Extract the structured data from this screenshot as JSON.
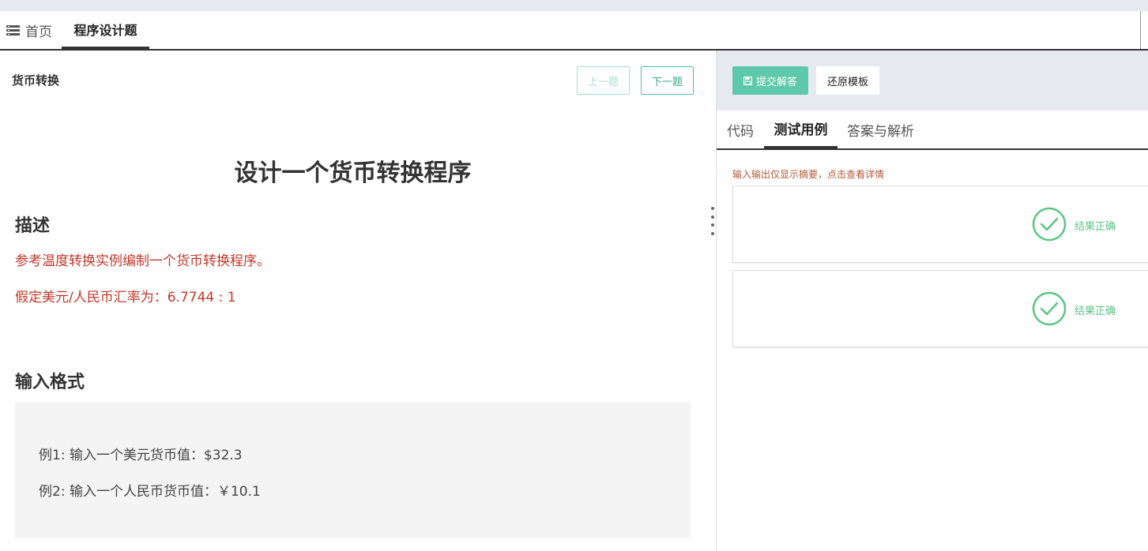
{
  "tabbar": {
    "home_label": "首页",
    "active_label": "程序设计题",
    "home_icon": "menu-icon"
  },
  "problem": {
    "name": "货币转换",
    "prev_label": "上一题",
    "next_label": "下一题",
    "title": "设计一个货币转换程序",
    "desc_heading": "描述",
    "desc_line1": "参考温度转换实例编制一个货币转换程序。",
    "desc_line2": "假定美元/人民币汇率为：6.7744 : 1",
    "input_heading": "输入格式",
    "example1": "例1: 输入一个美元货币值：$32.3",
    "example2": "例2: 输入一个人民币货币值：￥10.1"
  },
  "right": {
    "submit_label": "提交解答",
    "submit_icon": "save-icon",
    "restore_label": "还原模板",
    "tabs": [
      {
        "label": "代码"
      },
      {
        "label": "测试用例"
      },
      {
        "label": "答案与解析"
      }
    ],
    "active_tab": "测试用例",
    "hint": "输入输出仅显示摘要，点击查看详情",
    "cases": [
      {
        "result": "结果正确",
        "icon": "check-circle-icon"
      },
      {
        "result": "结果正确",
        "icon": "check-circle-icon"
      }
    ]
  },
  "colors": {
    "accent": "#5ec8aa",
    "error_text": "#c0392b",
    "success": "#5cc585"
  }
}
